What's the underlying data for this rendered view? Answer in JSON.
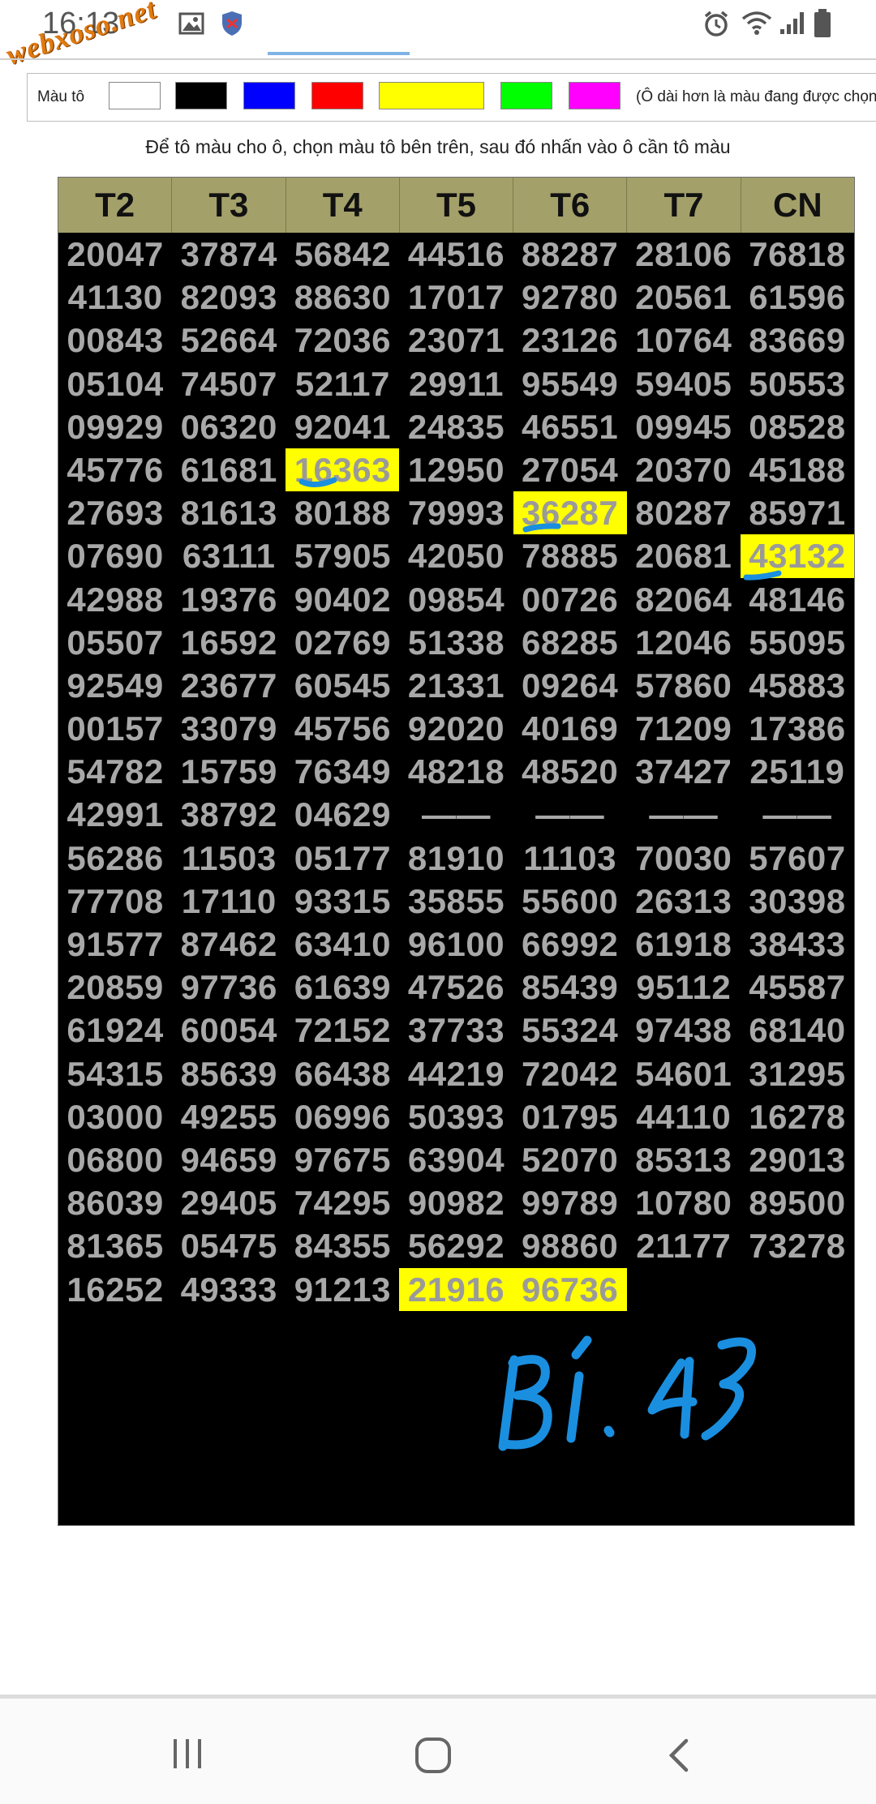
{
  "status_bar": {
    "time": "16:13",
    "watermark": "webxoso.net",
    "icons": [
      "gallery-icon",
      "shield-app-icon",
      "alarm-icon",
      "wifi-icon",
      "signal-icon",
      "battery-icon"
    ]
  },
  "palette": {
    "label": "Màu tô",
    "swatches": [
      {
        "name": "white",
        "color": "#ffffff"
      },
      {
        "name": "black",
        "color": "#000000"
      },
      {
        "name": "blue",
        "color": "#0000ff"
      },
      {
        "name": "red",
        "color": "#ff0000"
      },
      {
        "name": "yellow",
        "color": "#ffff00"
      },
      {
        "name": "green",
        "color": "#00ff00"
      },
      {
        "name": "magenta",
        "color": "#ff00ff"
      }
    ],
    "hint": "(Ô dài hơn là màu đang được chọn)"
  },
  "instruction": "Để tô màu cho ô, chọn màu tô bên trên, sau đó nhấn vào ô cần tô màu",
  "table": {
    "headers": [
      "T2",
      "T3",
      "T4",
      "T5",
      "T6",
      "T7",
      "CN"
    ],
    "rows": [
      [
        "20047",
        "37874",
        "56842",
        "44516",
        "88287",
        "28106",
        "76818"
      ],
      [
        "41130",
        "82093",
        "88630",
        "17017",
        "92780",
        "20561",
        "61596"
      ],
      [
        "00843",
        "52664",
        "72036",
        "23071",
        "23126",
        "10764",
        "83669"
      ],
      [
        "05104",
        "74507",
        "52117",
        "29911",
        "95549",
        "59405",
        "50553"
      ],
      [
        "09929",
        "06320",
        "92041",
        "24835",
        "46551",
        "09945",
        "08528"
      ],
      [
        "45776",
        "61681",
        "16363",
        "12950",
        "27054",
        "20370",
        "45188"
      ],
      [
        "27693",
        "81613",
        "80188",
        "79993",
        "36287",
        "80287",
        "85971"
      ],
      [
        "07690",
        "63111",
        "57905",
        "42050",
        "78885",
        "20681",
        "43132"
      ],
      [
        "42988",
        "19376",
        "90402",
        "09854",
        "00726",
        "82064",
        "48146"
      ],
      [
        "05507",
        "16592",
        "02769",
        "51338",
        "68285",
        "12046",
        "55095"
      ],
      [
        "92549",
        "23677",
        "60545",
        "21331",
        "09264",
        "57860",
        "45883"
      ],
      [
        "00157",
        "33079",
        "45756",
        "92020",
        "40169",
        "71209",
        "17386"
      ],
      [
        "54782",
        "15759",
        "76349",
        "48218",
        "48520",
        "37427",
        "25119"
      ],
      [
        "42991",
        "38792",
        "04629",
        "——",
        "——",
        "——",
        "——"
      ],
      [
        "56286",
        "11503",
        "05177",
        "81910",
        "11103",
        "70030",
        "57607"
      ],
      [
        "77708",
        "17110",
        "93315",
        "35855",
        "55600",
        "26313",
        "30398"
      ],
      [
        "91577",
        "87462",
        "63410",
        "96100",
        "66992",
        "61918",
        "38433"
      ],
      [
        "20859",
        "97736",
        "61639",
        "47526",
        "85439",
        "95112",
        "45587"
      ],
      [
        "61924",
        "60054",
        "72152",
        "37733",
        "55324",
        "97438",
        "68140"
      ],
      [
        "54315",
        "85639",
        "66438",
        "44219",
        "72042",
        "54601",
        "31295"
      ],
      [
        "03000",
        "49255",
        "06996",
        "50393",
        "01795",
        "44110",
        "16278"
      ],
      [
        "06800",
        "94659",
        "97675",
        "63904",
        "52070",
        "85313",
        "29013"
      ],
      [
        "86039",
        "29405",
        "74295",
        "90982",
        "99789",
        "10780",
        "89500"
      ],
      [
        "81365",
        "05475",
        "84355",
        "56292",
        "98860",
        "21177",
        "73278"
      ],
      [
        "16252",
        "49333",
        "91213",
        "21916",
        "96736",
        "",
        ""
      ]
    ],
    "highlighted": [
      "5-2",
      "6-4",
      "7-6",
      "24-3",
      "24-4"
    ],
    "highlight_color": "#ffff00"
  },
  "handwritten_note": "BÍ. 43",
  "nav": {
    "icons": [
      "recent-apps-icon",
      "home-icon",
      "back-icon"
    ]
  }
}
